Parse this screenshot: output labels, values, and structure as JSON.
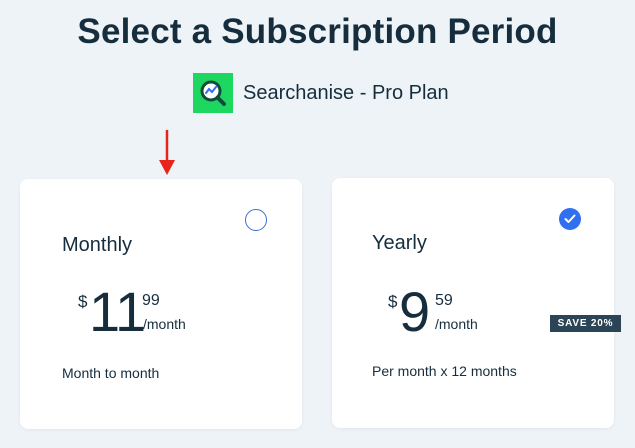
{
  "page": {
    "title": "Select a Subscription Period",
    "app_name": "Searchanise - Pro Plan"
  },
  "plans": [
    {
      "name": "Monthly",
      "currency": "$",
      "dollars": "11",
      "cents": "99",
      "per": "/month",
      "note": "Month to month",
      "selected": false
    },
    {
      "name": "Yearly",
      "currency": "$",
      "dollars": "9",
      "cents": "59",
      "per": "/month",
      "note": "Per month x 12 months",
      "selected": true,
      "badge": "SAVE 20%"
    }
  ],
  "colors": {
    "background": "#eef3f7",
    "text": "#162d3d",
    "accent": "#2f6ff0",
    "logo_bg": "#1ed760",
    "badge_bg": "#2b4556",
    "arrow": "#e8231a"
  },
  "icons": {
    "app_logo": "magnifier-chart-icon",
    "arrow": "red-arrow-down-icon",
    "check": "check-icon"
  }
}
